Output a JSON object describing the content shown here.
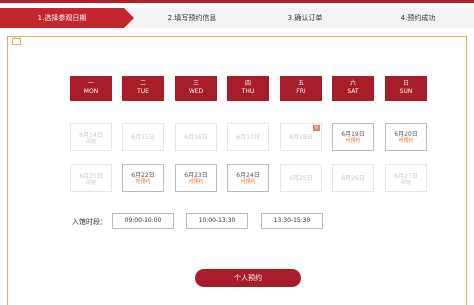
{
  "steps": [
    {
      "label": "1.选择参观日期"
    },
    {
      "label": "2.填写预约信息"
    },
    {
      "label": "3.确认订单"
    },
    {
      "label": "4.预约成功"
    }
  ],
  "weekdays": [
    {
      "cn": "一",
      "en": "MON"
    },
    {
      "cn": "二",
      "en": "TUE"
    },
    {
      "cn": "三",
      "en": "WED"
    },
    {
      "cn": "四",
      "en": "THU"
    },
    {
      "cn": "五",
      "en": "FRI"
    },
    {
      "cn": "六",
      "en": "SAT"
    },
    {
      "cn": "日",
      "en": "SUN"
    }
  ],
  "week1": [
    {
      "date": "6月14日",
      "status": "闭馆"
    },
    {
      "date": "6月15日",
      "status": ""
    },
    {
      "date": "6月16日",
      "status": ""
    },
    {
      "date": "6月17日",
      "status": ""
    },
    {
      "date": "6月18日",
      "status": "",
      "tag": "节"
    },
    {
      "date": "6月19日",
      "status": "可预约"
    },
    {
      "date": "6月20日",
      "status": "可预约"
    }
  ],
  "week2": [
    {
      "date": "6月21日",
      "status": "闭馆"
    },
    {
      "date": "6月22日",
      "status": "可预约"
    },
    {
      "date": "6月23日",
      "status": "可预约"
    },
    {
      "date": "6月24日",
      "status": "可预约"
    },
    {
      "date": "6月25日",
      "status": ""
    },
    {
      "date": "6月26日",
      "status": ""
    },
    {
      "date": "6月27日",
      "status": "闭馆"
    }
  ],
  "time": {
    "label": "入馆时段：",
    "slots": [
      "09:00-10:00",
      "10:00-13:30",
      "13:30-15:30"
    ]
  },
  "submit_label": "个人预约",
  "colors": {
    "accent": "#a71d2a",
    "available": "#e0752b",
    "border_gold": "#d9b45c"
  }
}
